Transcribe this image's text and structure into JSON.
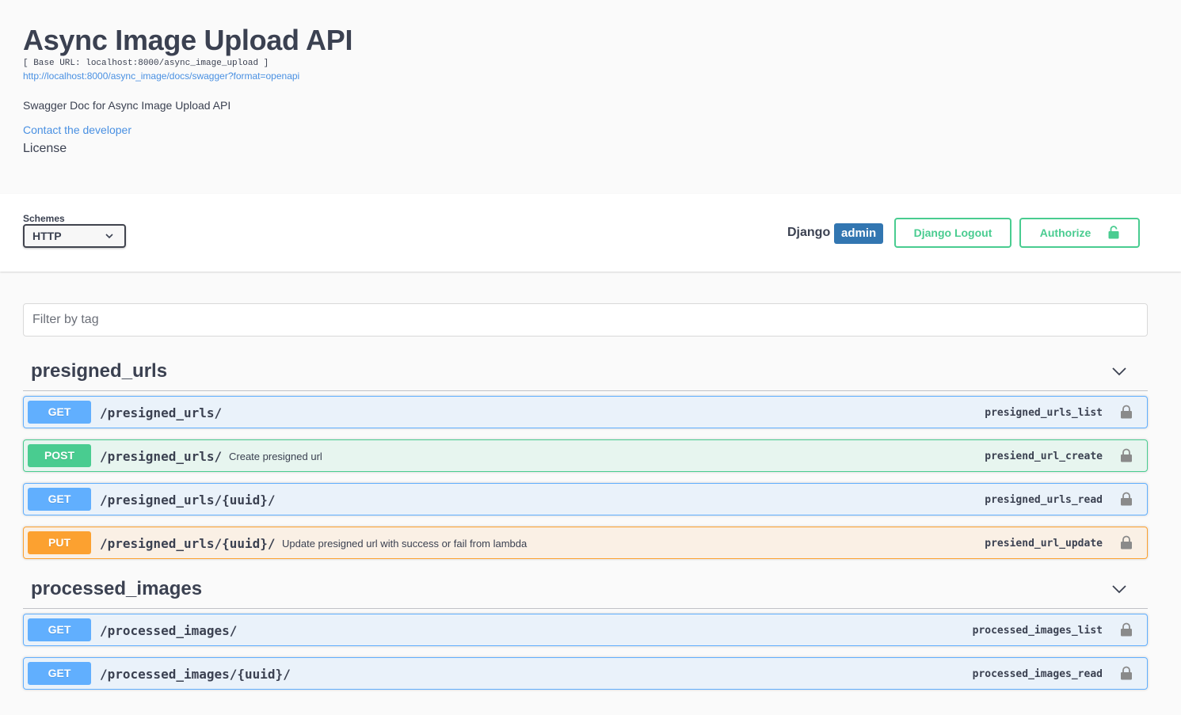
{
  "info": {
    "title": "Async Image Upload API",
    "base_url": "[ Base URL: localhost:8000/async_image_upload ]",
    "spec_link": "http://localhost:8000/async_image/docs/swagger?format=openapi",
    "description": "Swagger Doc for Async Image Upload API",
    "contact_link": "Contact the developer",
    "license": "License"
  },
  "scheme_bar": {
    "schemes_label": "Schemes",
    "selected_scheme": "HTTP",
    "django_label": "Django",
    "user_badge": "admin",
    "logout_label": "Django Logout",
    "authorize_label": "Authorize"
  },
  "filter": {
    "placeholder": "Filter by tag"
  },
  "tags": [
    {
      "name": "presigned_urls",
      "operations": [
        {
          "method": "GET",
          "path": "/presigned_urls/",
          "summary": "",
          "operation_id": "presigned_urls_list"
        },
        {
          "method": "POST",
          "path": "/presigned_urls/",
          "summary": "Create presigned url",
          "operation_id": "presiend_url_create"
        },
        {
          "method": "GET",
          "path": "/presigned_urls/{uuid}/",
          "summary": "",
          "operation_id": "presigned_urls_read"
        },
        {
          "method": "PUT",
          "path": "/presigned_urls/{uuid}/",
          "summary": "Update presigned url with success or fail from lambda",
          "operation_id": "presiend_url_update"
        }
      ]
    },
    {
      "name": "processed_images",
      "operations": [
        {
          "method": "GET",
          "path": "/processed_images/",
          "summary": "",
          "operation_id": "processed_images_list"
        },
        {
          "method": "GET",
          "path": "/processed_images/{uuid}/",
          "summary": "",
          "operation_id": "processed_images_read"
        }
      ]
    }
  ],
  "colors": {
    "get": "#61affe",
    "post": "#49cc90",
    "put": "#fca130",
    "link": "#4990e2",
    "badge": "#3276b1"
  },
  "icons": {
    "scheme_dropdown": "chevron-down-icon",
    "tag_toggle": "chevron-down-icon",
    "authorize": "unlocked-padlock-icon",
    "operation": "padlock-icon"
  }
}
